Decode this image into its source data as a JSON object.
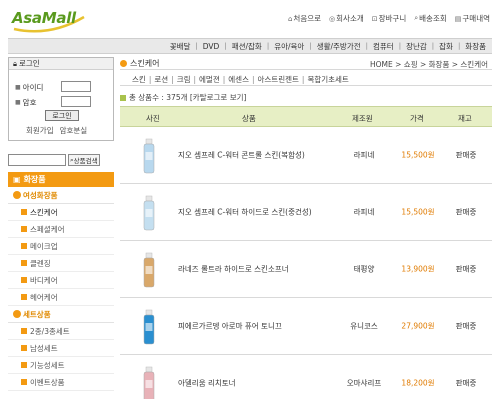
{
  "header": {
    "logo_text": "AsaMall",
    "links": [
      {
        "icon": "house-icon",
        "glyph": "⌂",
        "label": "처음으로"
      },
      {
        "icon": "info-icon",
        "glyph": "◎",
        "label": "회사소개"
      },
      {
        "icon": "cart-icon",
        "glyph": "⊡",
        "label": "장바구니"
      },
      {
        "icon": "search-icon",
        "glyph": "⌕",
        "label": "배송조회"
      },
      {
        "icon": "list-icon",
        "glyph": "▤",
        "label": "구매내역"
      }
    ]
  },
  "categories": [
    "꽃배달",
    "DVD",
    "패션/잡화",
    "유아/육아",
    "생활/주방가전",
    "컴퓨터",
    "장난감",
    "잡화",
    "화장품"
  ],
  "sidebar": {
    "login": {
      "title": "로그인",
      "id_label": "아이디",
      "pw_label": "암호",
      "button": "로그인",
      "join": "회원가입",
      "find_pw": "암호분실"
    },
    "search_button": "상품검색",
    "category_title": "화장품",
    "groups": [
      {
        "label": "여성화장품",
        "items": [
          "스킨케어",
          "스페셜케어",
          "메이크업",
          "클렌징",
          "바디케어",
          "헤어케어"
        ]
      },
      {
        "label": "세트상품",
        "items": [
          "2종/3종세트",
          "남성세트",
          "기능성세트",
          "이벤트상품"
        ]
      }
    ]
  },
  "main": {
    "title": "스킨케어",
    "breadcrumb": "HOME > 쇼핑 > 화장품 > 스킨케어",
    "subcats": [
      "스킨",
      "로션",
      "크림",
      "에멀젼",
      "에센스",
      "아스트린젠트",
      "복합기초세트"
    ],
    "count_text": "총 상품수 : 375개 [카탈로그로 보기]",
    "columns": {
      "photo": "사진",
      "product": "상품",
      "maker": "제조원",
      "price": "가격",
      "stock": "재고"
    },
    "products": [
      {
        "name": "지오 셈프레 C-워터 콘트롤 스킨(복합성)",
        "maker": "라피네",
        "price": "15,500원",
        "stock": "판매중",
        "bottle": "#b8d8ee"
      },
      {
        "name": "지오 셈프레 C-워터 하이드로 스킨(중건성)",
        "maker": "라피네",
        "price": "15,500원",
        "stock": "판매중",
        "bottle": "#c4dff0"
      },
      {
        "name": "라네즈 롤트라 하이드로 스킨소프너",
        "maker": "태평양",
        "price": "13,900원",
        "stock": "판매중",
        "bottle": "#d9a86a"
      },
      {
        "name": "피에르가르뎅 아로마 퓨어 토니끄",
        "maker": "유니코스",
        "price": "27,900원",
        "stock": "판매중",
        "bottle": "#2a8fd0"
      },
      {
        "name": "아델리움 리치토너",
        "maker": "오마샤리프",
        "price": "18,200원",
        "stock": "판매중",
        "bottle": "#e8b2b8"
      }
    ]
  }
}
